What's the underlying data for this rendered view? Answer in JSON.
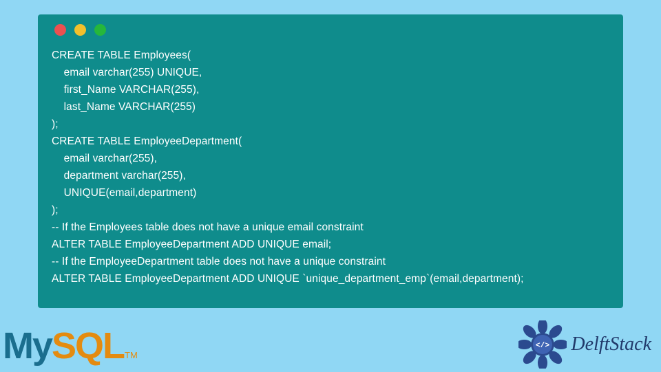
{
  "code": {
    "lines": [
      "CREATE TABLE Employees(",
      "    email varchar(255) UNIQUE,",
      "    first_Name VARCHAR(255),",
      "    last_Name VARCHAR(255)",
      ");",
      "CREATE TABLE EmployeeDepartment(",
      "    email varchar(255),",
      "    department varchar(255),",
      "    UNIQUE(email,department)",
      ");",
      "-- If the Employees table does not have a unique email constraint",
      "ALTER TABLE EmployeeDepartment ADD UNIQUE email;",
      "-- If the EmployeeDepartment table does not have a unique constraint",
      "ALTER TABLE EmployeeDepartment ADD UNIQUE `unique_department_emp`(email,department);"
    ]
  },
  "branding": {
    "mysql_my": "My",
    "mysql_sql": "SQL",
    "mysql_tm": "TM",
    "delft": "DelftStack"
  },
  "colors": {
    "page_bg": "#90d7f4",
    "panel_bg": "#0f8c8c",
    "code_fg": "#ffffff",
    "mysql_my": "#1a6e8e",
    "mysql_sql": "#e48b10",
    "delft": "#213a6b"
  }
}
